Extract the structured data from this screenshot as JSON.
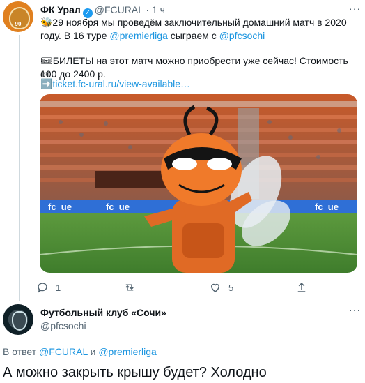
{
  "tweet1": {
    "name": "ФК Урал",
    "handle": "@FCURAL",
    "sep": "·",
    "time": "1 ч",
    "avatar_number": "90",
    "line1_pre": "🐝29 ноября мы проведём заключительный домашний матч в 2020",
    "line2_pre": "году. В 16 туре ",
    "mention1": "@premierliga",
    "line2_mid": " сыграем с ",
    "mention2": "@pfcsochi",
    "line3": "🎟БИЛЕТЫ на этот матч можно приобрести уже сейчас! Стоимость от",
    "line4": "100 до 2400 р.",
    "link": "➡️ticket.fc-ural.ru/view-available…",
    "image_banner1": "fc_ue",
    "image_banner2": "fc_ue",
    "image_banner3": "fc_ue",
    "reply_count": "1",
    "retweet_count": "",
    "like_count": "5"
  },
  "tweet2": {
    "name": "Футбольный клуб «Сочи»",
    "handle": "@pfcsochi",
    "reply_to_prefix": "В ответ",
    "reply_to_user1": "@FCURAL",
    "reply_to_and": "и",
    "reply_to_user2": "@premierliga",
    "text": "А можно закрыть крышу будет? Холодно"
  },
  "colors": {
    "link": "#1b95e0",
    "muted": "#536471",
    "verified": "#1d9bf0"
  }
}
